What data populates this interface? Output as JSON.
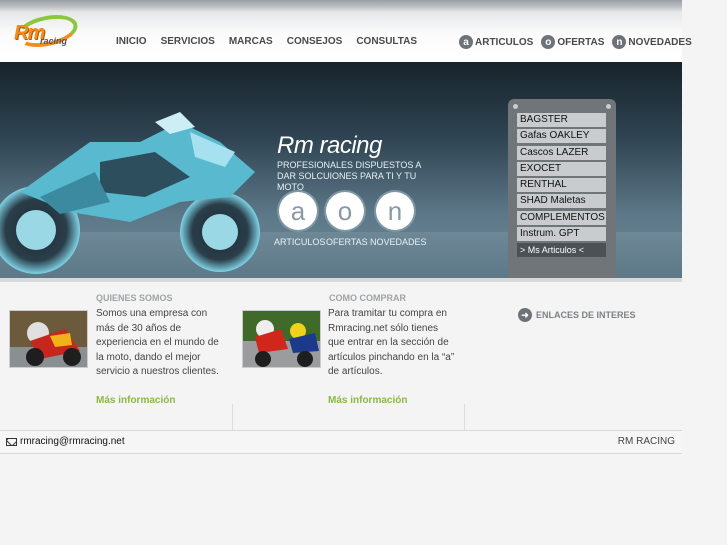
{
  "logo": {
    "main": "Rm",
    "sub": "racing"
  },
  "nav": {
    "items": [
      "INICIO",
      "SERVICIOS",
      "MARCAS",
      "CONSEJOS",
      "CONSULTAS"
    ]
  },
  "rightnav": [
    {
      "icon": "a",
      "label": "ARTICULOS"
    },
    {
      "icon": "o",
      "label": "OFERTAS"
    },
    {
      "icon": "n",
      "label": "NOVEDADES"
    }
  ],
  "banner": {
    "title": "Rm racing",
    "subtitle": "PROFESIONALES DISPUESTOS A DAR SOLCUIONES PARA TI Y TU MOTO",
    "icons": [
      {
        "letter": "a",
        "label": "ARTICULOS"
      },
      {
        "letter": "o",
        "label": "OFERTAS"
      },
      {
        "letter": "n",
        "label": "NOVEDADES"
      }
    ]
  },
  "brands": [
    "BAGSTER",
    "Gafas OAKLEY",
    "Cascos LAZER",
    "EXOCET",
    "RENTHAL",
    "SHAD Maletas",
    "COMPLEMENTOS",
    "Instrum. GPT",
    "> Ms Articulos <"
  ],
  "quienes": {
    "title": "QUIENES SOMOS",
    "lines": [
      "Somos una empresa con",
      "más de 30 años de",
      "experiencia en el mundo de",
      "la moto, dando el mejor",
      "servicio a nuestros clientes."
    ],
    "more": "Más información"
  },
  "comprar": {
    "title": "COMO COMPRAR",
    "lines": [
      "Para tramitar tu compra en",
      "Rmracing.net sólo tienes",
      "que entrar en la sección de",
      "artículos pinchando en la “a”",
      "de artículos."
    ],
    "more": "Más información"
  },
  "enlaces": {
    "label": "ENLACES DE INTERES"
  },
  "footer": {
    "email": "rmracing@rmracing.net",
    "brand": "RM RACING"
  },
  "colors": {
    "accent": "#8ab845",
    "banner": "#3f5a68",
    "logo_orange": "#f28c1e"
  }
}
